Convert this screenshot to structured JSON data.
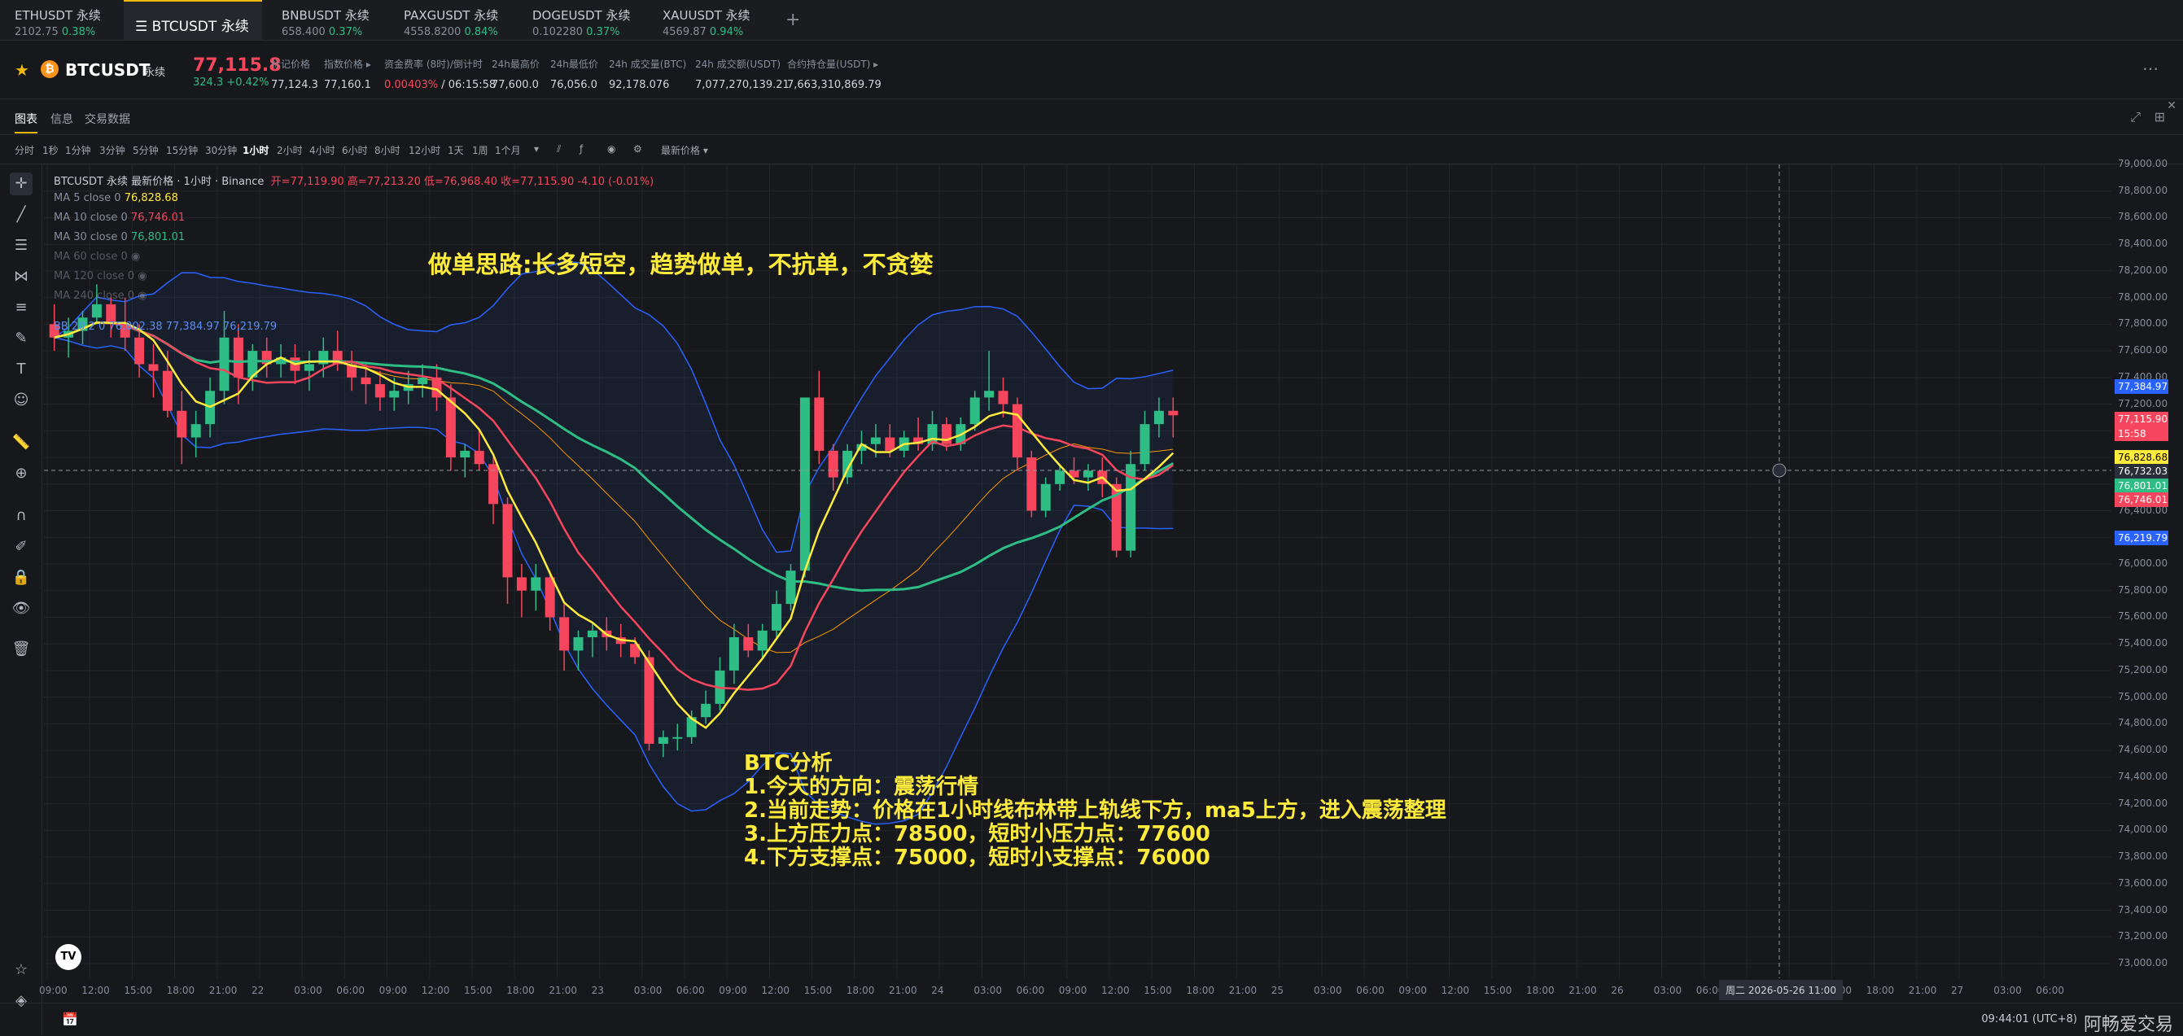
{
  "tabs": [
    {
      "name": "ETHUSDT 永续",
      "price": "2102.75",
      "pct": "0.38%"
    },
    {
      "name": "BTCUSDT 永续",
      "price": "",
      "pct": ""
    },
    {
      "name": "BNBUSDT 永续",
      "price": "658.400",
      "pct": "0.37%"
    },
    {
      "name": "PAXGUSDT 永续",
      "price": "4558.8200",
      "pct": "0.84%"
    },
    {
      "name": "DOGEUSDT 永续",
      "price": "0.102280",
      "pct": "0.37%"
    },
    {
      "name": "XAUUSDT 永续",
      "price": "4569.87",
      "pct": "0.94%"
    }
  ],
  "header": {
    "symbol": "BTCUSDT",
    "tag": "永续",
    "price": "77,115.8",
    "change": "324.3 +0.42%",
    "stats": [
      {
        "label": "标记价格",
        "value": "77,124.3"
      },
      {
        "label": "指数价格 ▸",
        "value": "77,160.1"
      },
      {
        "label": "资金费率 (8时)/倒计时",
        "value_red": "0.00403%",
        "value": "/ 06:15:58"
      },
      {
        "label": "24h最高价",
        "value": "77,600.0"
      },
      {
        "label": "24h最低价",
        "value": "76,056.0"
      },
      {
        "label": "24h 成交量(BTC)",
        "value": "92,178.076"
      },
      {
        "label": "24h 成交额(USDT)",
        "value": "7,077,270,139.21"
      },
      {
        "label": "合约持仓量(USDT) ▸",
        "value": "7,663,310,869.79"
      }
    ]
  },
  "subtabs": [
    "图表",
    "信息",
    "交易数据"
  ],
  "timeframes": [
    "分时",
    "1秒",
    "1分钟",
    "3分钟",
    "5分钟",
    "15分钟",
    "30分钟",
    "1小时",
    "2小时",
    "4小时",
    "6小时",
    "8小时",
    "12小时",
    "1天",
    "1周",
    "1个月",
    "▾",
    "最新价格 ▾"
  ],
  "legend": {
    "title": "BTCUSDT 永续 最新价格 · 1小时 · Binance",
    "ohlc": "开=77,119.90 高=77,213.20 低=76,968.40 收=77,115.90 -4.10 (-0.01%)",
    "ma": [
      {
        "label": "MA 5 close 0",
        "value": "76,828.68"
      },
      {
        "label": "MA 10 close 0",
        "value": "76,746.01"
      },
      {
        "label": "MA 30 close 0",
        "value": "76,801.01"
      },
      {
        "label": "MA 60 close 0",
        "value": ""
      },
      {
        "label": "MA 120 close 0",
        "value": ""
      },
      {
        "label": "MA 240 close 0",
        "value": ""
      }
    ],
    "bb": "BB 20 2 0  76,802.38  77,384.97  76,219.79"
  },
  "annotations": {
    "title": "做单思路:长多短空，趋势做单，不抗单，不贪婪",
    "lines": [
      "BTC分析",
      "1.今天的方向：震荡行情",
      "2.当前走势：价格在1小时线布林带上轨线下方，ma5上方，进入震荡整理",
      "3.上方压力点：78500，短时小压力点：77600",
      "4.下方支撑点：75000，短时小支撑点：76000"
    ]
  },
  "price_axis": [
    "79,000.00",
    "78,800.00",
    "78,600.00",
    "78,400.00",
    "78,200.00",
    "78,000.00",
    "77,800.00",
    "77,600.00",
    "77,400.00",
    "77,200.00",
    "77,000.00",
    "76,800.00",
    "76,600.00",
    "76,400.00",
    "76,200.00",
    "76,000.00",
    "75,800.00",
    "75,600.00",
    "75,400.00",
    "75,200.00",
    "75,000.00",
    "74,800.00",
    "74,600.00",
    "74,400.00",
    "74,200.00",
    "74,000.00",
    "73,800.00",
    "73,600.00",
    "73,400.00",
    "73,200.00",
    "73,000.00"
  ],
  "price_tags": [
    {
      "value": "77,384.97",
      "color": "#2962ff"
    },
    {
      "value": "77,115.90",
      "sub": "15:58",
      "color": "#f6465d"
    },
    {
      "value": "76,828.68",
      "color": "#ffeb3b"
    },
    {
      "value": "76,732.03",
      "color": "#2a2e39"
    },
    {
      "value": "76,801.01",
      "color": "#2ebd85"
    },
    {
      "value": "76,746.01",
      "color": "#f6465d"
    },
    {
      "value": "76,219.79",
      "color": "#2962ff"
    }
  ],
  "time_axis": [
    "09:00",
    "12:00",
    "15:00",
    "18:00",
    "21:00",
    "22",
    "03:00",
    "06:00",
    "09:00",
    "12:00",
    "15:00",
    "18:00",
    "21:00",
    "23",
    "03:00",
    "06:00",
    "09:00",
    "12:00",
    "15:00",
    "18:00",
    "21:00",
    "24",
    "03:00",
    "06:00",
    "09:00",
    "12:00",
    "15:00",
    "18:00",
    "21:00",
    "25",
    "03:00",
    "06:00",
    "09:00",
    "12:00",
    "15:00",
    "18:00",
    "21:00",
    "26",
    "03:00",
    "06:00",
    "09:00",
    "12:00",
    "15:00",
    "18:00",
    "21:00",
    "27",
    "03:00",
    "06:00"
  ],
  "crosshair_time": "周二 2026-05-26  11:00",
  "clock": "09:44:01 (UTC+8)",
  "watermark": "阿畅爱交易",
  "chart_data": {
    "type": "candlestick",
    "timeframe": "1小时",
    "ylim": [
      73000,
      79000
    ],
    "candles": [
      [
        77800,
        77950,
        77600,
        77700
      ],
      [
        77700,
        77850,
        77550,
        77750
      ],
      [
        77750,
        77900,
        77650,
        77850
      ],
      [
        77850,
        78100,
        77800,
        77950
      ],
      [
        77950,
        78000,
        77700,
        77800
      ],
      [
        77800,
        78000,
        77600,
        77700
      ],
      [
        77700,
        77800,
        77400,
        77500
      ],
      [
        77500,
        77650,
        77250,
        77450
      ],
      [
        77450,
        77600,
        77100,
        77150
      ],
      [
        77150,
        77300,
        76750,
        76950
      ],
      [
        76950,
        77150,
        76800,
        77050
      ],
      [
        77050,
        77400,
        76950,
        77300
      ],
      [
        77300,
        77900,
        77200,
        77700
      ],
      [
        77700,
        77800,
        77200,
        77400
      ],
      [
        77400,
        77650,
        77300,
        77600
      ],
      [
        77600,
        77700,
        77400,
        77500
      ],
      [
        77500,
        77650,
        77400,
        77550
      ],
      [
        77550,
        77650,
        77350,
        77450
      ],
      [
        77450,
        77600,
        77300,
        77500
      ],
      [
        77500,
        77700,
        77400,
        77600
      ],
      [
        77600,
        77750,
        77450,
        77500
      ],
      [
        77500,
        77600,
        77300,
        77400
      ],
      [
        77400,
        77500,
        77200,
        77350
      ],
      [
        77350,
        77450,
        77150,
        77250
      ],
      [
        77250,
        77400,
        77150,
        77300
      ],
      [
        77300,
        77450,
        77200,
        77350
      ],
      [
        77350,
        77500,
        77250,
        77400
      ],
      [
        77400,
        77500,
        77150,
        77250
      ],
      [
        77250,
        77350,
        76700,
        76800
      ],
      [
        76800,
        76900,
        76650,
        76850
      ],
      [
        76850,
        77000,
        76700,
        76750
      ],
      [
        76750,
        76800,
        76300,
        76450
      ],
      [
        76450,
        76500,
        75700,
        75900
      ],
      [
        75900,
        76000,
        75600,
        75800
      ],
      [
        75800,
        76000,
        75650,
        75900
      ],
      [
        75900,
        75950,
        75500,
        75600
      ],
      [
        75600,
        75700,
        75200,
        75350
      ],
      [
        75350,
        75500,
        75200,
        75450
      ],
      [
        75450,
        75550,
        75300,
        75500
      ],
      [
        75500,
        75600,
        75350,
        75450
      ],
      [
        75450,
        75550,
        75300,
        75400
      ],
      [
        75400,
        75450,
        75250,
        75300
      ],
      [
        75300,
        75350,
        74600,
        74650
      ],
      [
        74650,
        74750,
        74550,
        74700
      ],
      [
        74700,
        74800,
        74600,
        74700
      ],
      [
        74700,
        74900,
        74650,
        74850
      ],
      [
        74850,
        75050,
        74800,
        74950
      ],
      [
        74950,
        75300,
        74900,
        75200
      ],
      [
        75200,
        75550,
        75100,
        75450
      ],
      [
        75450,
        75550,
        75300,
        75350
      ],
      [
        75350,
        75550,
        75300,
        75500
      ],
      [
        75500,
        75800,
        75450,
        75700
      ],
      [
        75700,
        76000,
        75650,
        75950
      ],
      [
        75950,
        76900,
        75900,
        77250
      ],
      [
        77250,
        77450,
        76750,
        76850
      ],
      [
        76850,
        76900,
        76550,
        76650
      ],
      [
        76650,
        76900,
        76600,
        76850
      ],
      [
        76850,
        77000,
        76750,
        76900
      ],
      [
        76900,
        77050,
        76800,
        76950
      ],
      [
        76950,
        77050,
        76800,
        76850
      ],
      [
        76850,
        77000,
        76800,
        76950
      ],
      [
        76950,
        77100,
        76850,
        76900
      ],
      [
        76900,
        77150,
        76850,
        77050
      ],
      [
        77050,
        77100,
        76850,
        76900
      ],
      [
        76900,
        77100,
        76850,
        77050
      ],
      [
        77050,
        77300,
        77000,
        77250
      ],
      [
        77250,
        77600,
        77150,
        77300
      ],
      [
        77300,
        77400,
        77100,
        77200
      ],
      [
        77200,
        77250,
        76700,
        76800
      ],
      [
        76800,
        76850,
        76350,
        76400
      ],
      [
        76400,
        76650,
        76350,
        76600
      ],
      [
        76600,
        76750,
        76550,
        76700
      ],
      [
        76700,
        76800,
        76600,
        76650
      ],
      [
        76650,
        76750,
        76550,
        76700
      ],
      [
        76700,
        76800,
        76500,
        76600
      ],
      [
        76600,
        76650,
        76050,
        76100
      ],
      [
        76100,
        76850,
        76050,
        76750
      ],
      [
        76750,
        77150,
        76700,
        77050
      ],
      [
        77050,
        77250,
        76950,
        77150
      ],
      [
        77150,
        77250,
        76950,
        77115.9
      ]
    ]
  }
}
